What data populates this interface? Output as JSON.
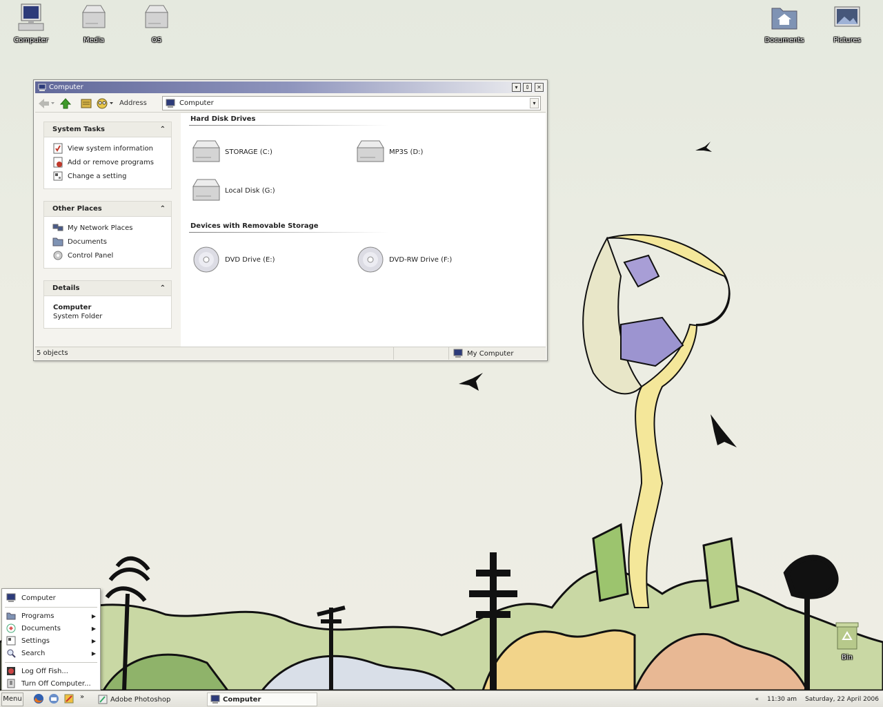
{
  "desktop": {
    "icons": [
      {
        "label": "Computer",
        "icon": "computer-icon"
      },
      {
        "label": "Media",
        "icon": "drive-icon"
      },
      {
        "label": "OS",
        "icon": "drive-icon"
      },
      {
        "label": "Documents",
        "icon": "home-folder-icon"
      },
      {
        "label": "Pictures",
        "icon": "pictures-icon"
      },
      {
        "label": "Bin",
        "icon": "recycle-bin-icon"
      }
    ]
  },
  "window": {
    "title": "Computer",
    "address_label": "Address",
    "address_value": "Computer",
    "left_panels": {
      "system_tasks": {
        "title": "System Tasks",
        "items": [
          "View system information",
          "Add or remove programs",
          "Change a setting"
        ]
      },
      "other_places": {
        "title": "Other Places",
        "items": [
          "My Network Places",
          "Documents",
          "Control Panel"
        ]
      },
      "details": {
        "title": "Details",
        "name": "Computer",
        "type": "System Folder"
      }
    },
    "groups": {
      "hard_disk": {
        "title": "Hard Disk Drives",
        "drives": [
          "STORAGE (C:)",
          "MP3S (D:)",
          "Local Disk (G:)"
        ]
      },
      "removable": {
        "title": "Devices with Removable Storage",
        "drives": [
          "DVD Drive (E:)",
          "DVD-RW Drive (F:)"
        ]
      }
    },
    "status": {
      "objects": "5 objects",
      "zone": "My Computer"
    }
  },
  "start_menu": {
    "top_item": "Computer",
    "items": [
      "Programs",
      "Documents",
      "Settings",
      "Search"
    ],
    "logoff": "Log Off Fish...",
    "shutdown": "Turn Off Computer..."
  },
  "taskbar": {
    "start_label": "Menu",
    "more": "»",
    "tasks": [
      "Adobe Photoshop",
      "Computer"
    ],
    "tray_arrow": "«",
    "time": "11:30 am",
    "date": "Saturday, 22 April 2006"
  }
}
